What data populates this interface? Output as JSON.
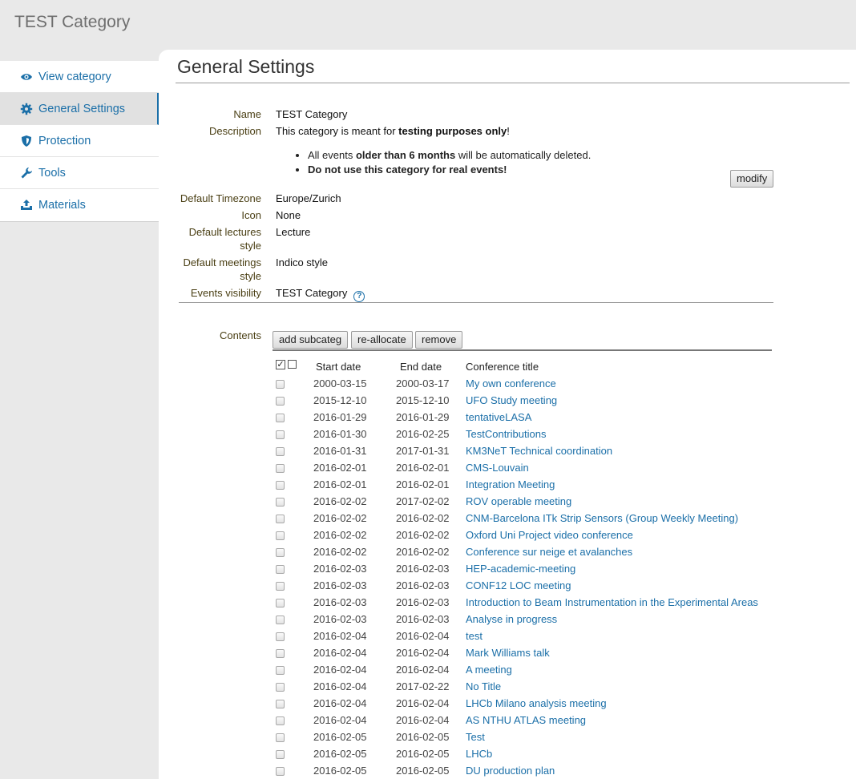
{
  "header": {
    "category_title": "TEST Category"
  },
  "sidebar": {
    "items": [
      {
        "label": "View category",
        "icon": "eye-icon"
      },
      {
        "label": "General Settings",
        "icon": "gear-icon",
        "active": true
      },
      {
        "label": "Protection",
        "icon": "shield-icon"
      },
      {
        "label": "Tools",
        "icon": "wrench-icon"
      },
      {
        "label": "Materials",
        "icon": "upload-icon"
      }
    ]
  },
  "main": {
    "title": "General Settings",
    "fields": {
      "name_label": "Name",
      "name_value": "TEST Category",
      "description_label": "Description",
      "description_pre": "This category is meant for ",
      "description_bold": "testing purposes only",
      "description_post": "!",
      "bullet1_pre": "All events ",
      "bullet1_bold": "older than 6 months",
      "bullet1_post": " will be automatically deleted.",
      "bullet2": "Do not use this category for real events!",
      "modify_label": "modify",
      "timezone_label": "Default Timezone",
      "timezone_value": "Europe/Zurich",
      "icon_label": "Icon",
      "icon_value": "None",
      "lectures_label_1": "Default lectures",
      "lectures_label_2": "style",
      "lectures_value": "Lecture",
      "meetings_label_1": "Default meetings",
      "meetings_label_2": "style",
      "meetings_value": "Indico style",
      "visibility_label": "Events visibility",
      "visibility_value": "TEST Category",
      "help_glyph": "?"
    },
    "contents": {
      "label": "Contents",
      "buttons": {
        "add": "add subcateg",
        "reallocate": "re-allocate",
        "remove": "remove"
      },
      "columns": {
        "start": "Start date",
        "end": "End date",
        "title": "Conference title"
      },
      "select_all_glyph": "✓",
      "rows": [
        {
          "start": "2000-03-15",
          "end": "2000-03-17",
          "title": "My own conference"
        },
        {
          "start": "2015-12-10",
          "end": "2015-12-10",
          "title": "UFO Study meeting"
        },
        {
          "start": "2016-01-29",
          "end": "2016-01-29",
          "title": "tentativeLASA"
        },
        {
          "start": "2016-01-30",
          "end": "2016-02-25",
          "title": "TestContributions"
        },
        {
          "start": "2016-01-31",
          "end": "2017-01-31",
          "title": "KM3NeT Technical coordination"
        },
        {
          "start": "2016-02-01",
          "end": "2016-02-01",
          "title": "CMS-Louvain"
        },
        {
          "start": "2016-02-01",
          "end": "2016-02-01",
          "title": "Integration Meeting"
        },
        {
          "start": "2016-02-02",
          "end": "2017-02-02",
          "title": "ROV operable meeting"
        },
        {
          "start": "2016-02-02",
          "end": "2016-02-02",
          "title": "CNM-Barcelona ITk Strip Sensors (Group Weekly Meeting)"
        },
        {
          "start": "2016-02-02",
          "end": "2016-02-02",
          "title": "Oxford Uni Project video conference"
        },
        {
          "start": "2016-02-02",
          "end": "2016-02-02",
          "title": "Conference sur neige et avalanches"
        },
        {
          "start": "2016-02-03",
          "end": "2016-02-03",
          "title": "HEP-academic-meeting"
        },
        {
          "start": "2016-02-03",
          "end": "2016-02-03",
          "title": "CONF12 LOC meeting"
        },
        {
          "start": "2016-02-03",
          "end": "2016-02-03",
          "title": "Introduction to Beam Instrumentation in the Experimental Areas"
        },
        {
          "start": "2016-02-03",
          "end": "2016-02-03",
          "title": "Analyse in progress"
        },
        {
          "start": "2016-02-04",
          "end": "2016-02-04",
          "title": "test"
        },
        {
          "start": "2016-02-04",
          "end": "2016-02-04",
          "title": "Mark Williams talk"
        },
        {
          "start": "2016-02-04",
          "end": "2016-02-04",
          "title": "A meeting"
        },
        {
          "start": "2016-02-04",
          "end": "2017-02-22",
          "title": "No Title"
        },
        {
          "start": "2016-02-04",
          "end": "2016-02-04",
          "title": "LHCb Milano analysis meeting"
        },
        {
          "start": "2016-02-04",
          "end": "2016-02-04",
          "title": "AS NTHU ATLAS meeting"
        },
        {
          "start": "2016-02-05",
          "end": "2016-02-05",
          "title": "Test"
        },
        {
          "start": "2016-02-05",
          "end": "2016-02-05",
          "title": "LHCb"
        },
        {
          "start": "2016-02-05",
          "end": "2016-02-05",
          "title": "DU production plan"
        }
      ]
    }
  },
  "colors": {
    "link": "#1b6fa8",
    "label": "#4a3f14",
    "background": "#e9e9e9"
  }
}
